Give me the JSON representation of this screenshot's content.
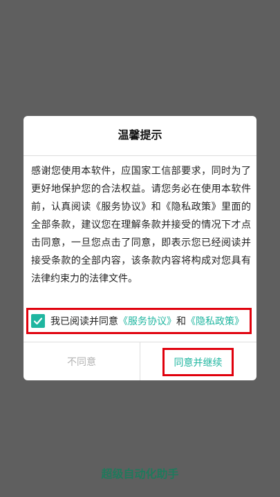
{
  "dialog": {
    "title": "温馨提示",
    "body": "感谢您使用本软件，应国家工信部要求，同时为了更好地保护您的合法权益。请您务必在使用本软件前，认真阅读《服务协议》和《隐私政策》里面的全部条款，建议您在理解条款并接受的情况下才点击同意，一旦您点击了同意，即表示您已经阅读并接受条款的全部内容，该条款内容将构成对您具有法律约束力的法律文件。",
    "agreement": {
      "checked": true,
      "prefix": "我已阅读并同意",
      "service_link": "《服务协议》",
      "conjunction": "和",
      "privacy_link": "《隐私政策》"
    },
    "disagree_label": "不同意",
    "agree_label": "同意并继续"
  },
  "footer": {
    "app_name": "超级自动化助手"
  },
  "colors": {
    "accent": "#1fb6a0",
    "highlight": "#e0000c",
    "overlay": "#5f5f5f",
    "app_name": "#1f7a5c"
  }
}
